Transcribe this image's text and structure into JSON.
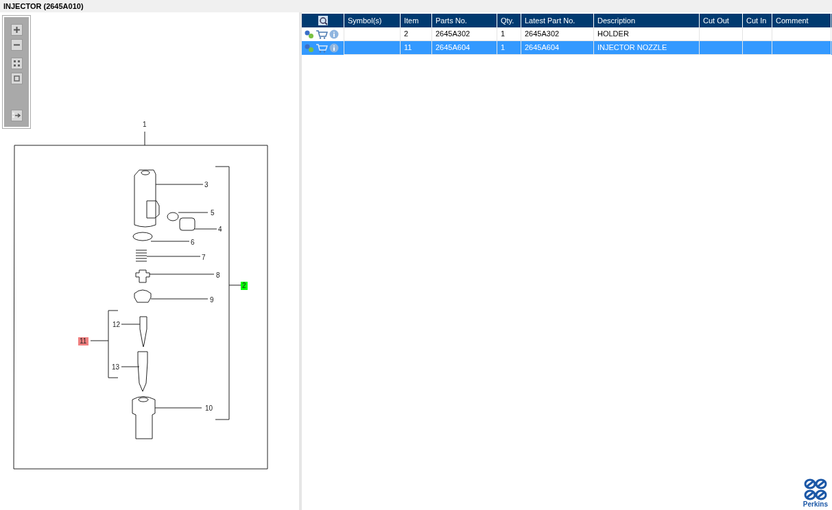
{
  "window": {
    "title": "INJECTOR (2645A010)"
  },
  "diagram": {
    "callouts": [
      {
        "label": "1"
      },
      {
        "label": "3"
      },
      {
        "label": "5"
      },
      {
        "label": "4"
      },
      {
        "label": "6"
      },
      {
        "label": "7"
      },
      {
        "label": "8"
      },
      {
        "label": "2",
        "color": "#00ff00"
      },
      {
        "label": "9"
      },
      {
        "label": "12"
      },
      {
        "label": "11",
        "color": "#f08080"
      },
      {
        "label": "13"
      },
      {
        "label": "10"
      }
    ]
  },
  "table": {
    "columns": [
      "Symbol(s)",
      "Item",
      "Parts No.",
      "Qty.",
      "Latest Part No.",
      "Description",
      "Cut Out",
      "Cut In",
      "Comment"
    ],
    "rows": [
      {
        "selected": false,
        "cells": [
          "",
          "2",
          "2645A302",
          "1",
          "2645A302",
          "HOLDER",
          "",
          "",
          ""
        ]
      },
      {
        "selected": true,
        "cells": [
          "",
          "11",
          "2645A604",
          "1",
          "2645A604",
          "INJECTOR NOZZLE",
          "",
          "",
          ""
        ]
      }
    ]
  },
  "logo": {
    "text": "Perkins"
  }
}
